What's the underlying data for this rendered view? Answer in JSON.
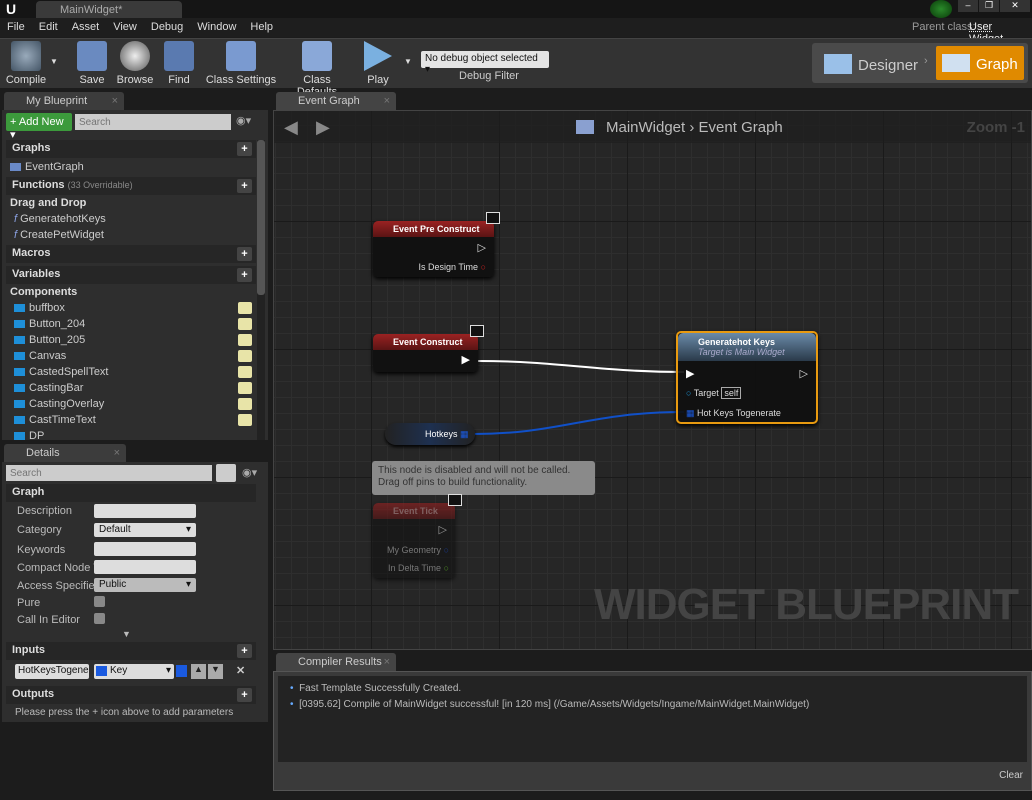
{
  "window": {
    "tab_title": "MainWidget*",
    "parent_class_label": "Parent class:",
    "parent_class": "User Widget"
  },
  "menu": [
    "File",
    "Edit",
    "Asset",
    "View",
    "Debug",
    "Window",
    "Help"
  ],
  "toolbar": {
    "compile": "Compile",
    "save": "Save",
    "browse": "Browse",
    "find": "Find",
    "class_settings": "Class Settings",
    "class_defaults": "Class Defaults",
    "play": "Play",
    "debug_object": "No debug object selected",
    "debug_filter": "Debug Filter",
    "designer": "Designer",
    "graph": "Graph"
  },
  "my_blueprint": {
    "tab": "My Blueprint",
    "add_new": "Add New",
    "search_placeholder": "Search",
    "graphs": "Graphs",
    "event_graph": "EventGraph",
    "functions": "Functions",
    "functions_count": "(33 Overridable)",
    "function_items": [
      "Drag and Drop",
      "GeneratehotKeys",
      "CreatePetWidget"
    ],
    "macros": "Macros",
    "variables": "Variables",
    "components": "Components",
    "variable_items": [
      "buffbox",
      "Button_204",
      "Button_205",
      "Canvas",
      "CastedSpellText",
      "CastingBar",
      "CastingOverlay",
      "CastTimeText",
      "DP"
    ]
  },
  "details": {
    "tab": "Details",
    "search_placeholder": "Search",
    "graph": "Graph",
    "rows": [
      {
        "label": "Description",
        "value": ""
      },
      {
        "label": "Category",
        "value": "Default"
      },
      {
        "label": "Keywords",
        "value": ""
      },
      {
        "label": "Compact Node Tit",
        "value": ""
      },
      {
        "label": "Access Specifier",
        "value": "Public"
      },
      {
        "label": "Pure",
        "value": ""
      },
      {
        "label": "Call In Editor",
        "value": ""
      }
    ],
    "pure_checked": false,
    "call_in_editor_checked": false,
    "inputs": "Inputs",
    "input_name": "HotKeysTogene",
    "input_type": "Key",
    "outputs": "Outputs",
    "outputs_hint": "Please press the + icon above to add parameters"
  },
  "graph": {
    "tab": "Event Graph",
    "breadcrumb_root": "MainWidget",
    "breadcrumb_sep": "›",
    "breadcrumb_current": "Event Graph",
    "zoom": "Zoom -1",
    "watermark": "WIDGET BLUEPRINT",
    "nodes": {
      "pre_construct": "Event Pre Construct",
      "is_design_time": "Is Design Time",
      "construct": "Event Construct",
      "generate_title": "Generatehot Keys",
      "generate_sub": "Target is Main Widget",
      "target": "Target",
      "self": "self",
      "hot_keys_pin": "Hot Keys Togenerate",
      "hotkeys_var": "Hotkeys",
      "disabled_comment": "This node is disabled and will not be called. Drag off pins to build functionality.",
      "tick": "Event Tick",
      "my_geometry": "My Geometry",
      "in_delta_time": "In Delta Time"
    }
  },
  "compiler": {
    "tab": "Compiler Results",
    "messages": [
      "Fast Template Successfully Created.",
      "[0395.62] Compile of MainWidget successful! [in 120 ms] (/Game/Assets/Widgets/Ingame/MainWidget.MainWidget)"
    ],
    "clear": "Clear"
  },
  "colors": {
    "accent": "#e08a00",
    "event_header": "#8e1f1f",
    "function_header": "#56718a",
    "exec_wire": "#ffffff",
    "array_wire": "#1050c8"
  }
}
